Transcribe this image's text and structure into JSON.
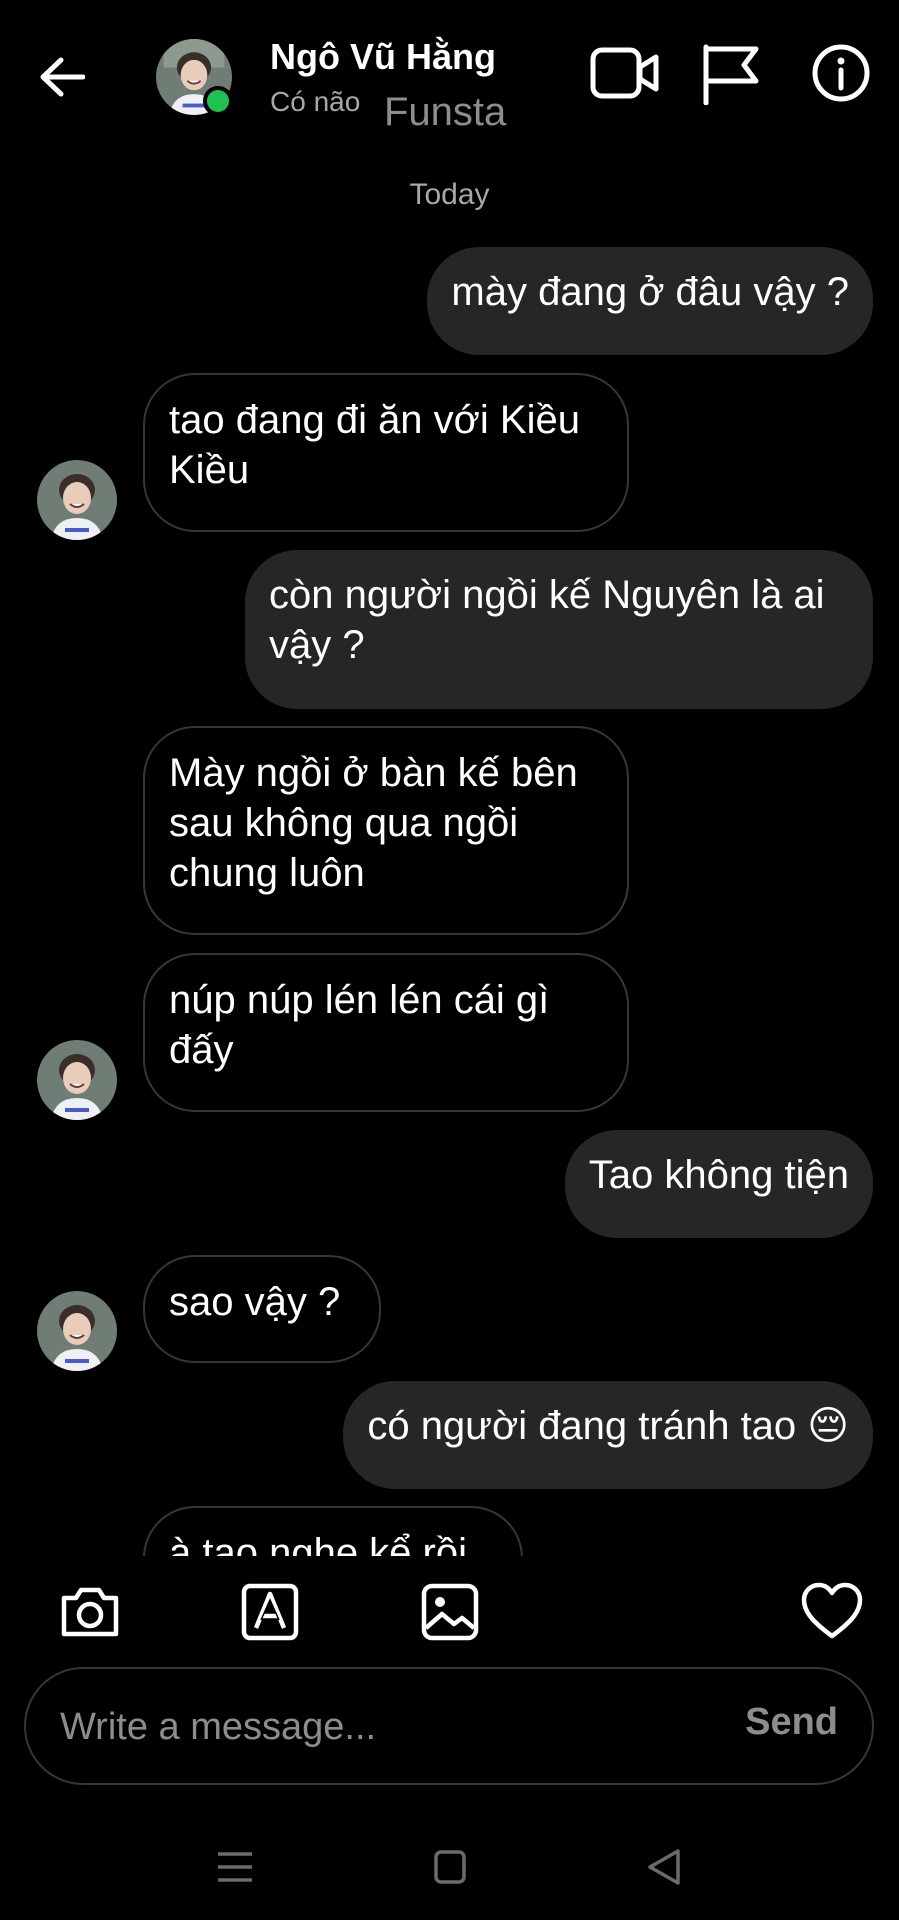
{
  "header": {
    "contact_name": "Ngô Vũ Hằng",
    "status": "Có não",
    "overlay_text": "Funsta",
    "icons": {
      "back": "back-arrow-icon",
      "video": "video-camera-icon",
      "report": "flag-icon",
      "info": "info-icon",
      "online": "online-status-dot"
    }
  },
  "chat": {
    "date_divider": "Today",
    "messages": [
      {
        "direction": "outgoing",
        "text": "mày đang ở đâu vậy ?"
      },
      {
        "direction": "incoming",
        "text": "tao đang đi ăn với Kiều Kiều"
      },
      {
        "direction": "outgoing",
        "text": "còn người ngồi kế Nguyên là ai vậy ?"
      },
      {
        "direction": "incoming",
        "text": "Mày ngồi ở bàn kế bên sau không qua ngồi chung luôn"
      },
      {
        "direction": "incoming",
        "text": "núp núp lén lén cái gì đấy"
      },
      {
        "direction": "outgoing",
        "text": "Tao không tiện"
      },
      {
        "direction": "incoming",
        "text": "sao vậy ?"
      },
      {
        "direction": "outgoing",
        "text": "có người đang tránh tao 😔"
      },
      {
        "direction": "incoming",
        "text": "à tao nghe kể rồi"
      }
    ]
  },
  "toolbar": {
    "icons": [
      "camera-icon",
      "sticker-icon",
      "gallery-icon",
      "heart-icon"
    ]
  },
  "composer": {
    "placeholder": "Write a message...",
    "send_label": "Send"
  },
  "system_nav": {
    "icons": [
      "menu-icon",
      "home-icon",
      "back-triangle-icon"
    ]
  },
  "colors": {
    "background": "#000000",
    "outgoing_bubble": "#262626",
    "incoming_border": "#363636",
    "muted_text": "#a8a8a8",
    "online": "#1fc250"
  }
}
